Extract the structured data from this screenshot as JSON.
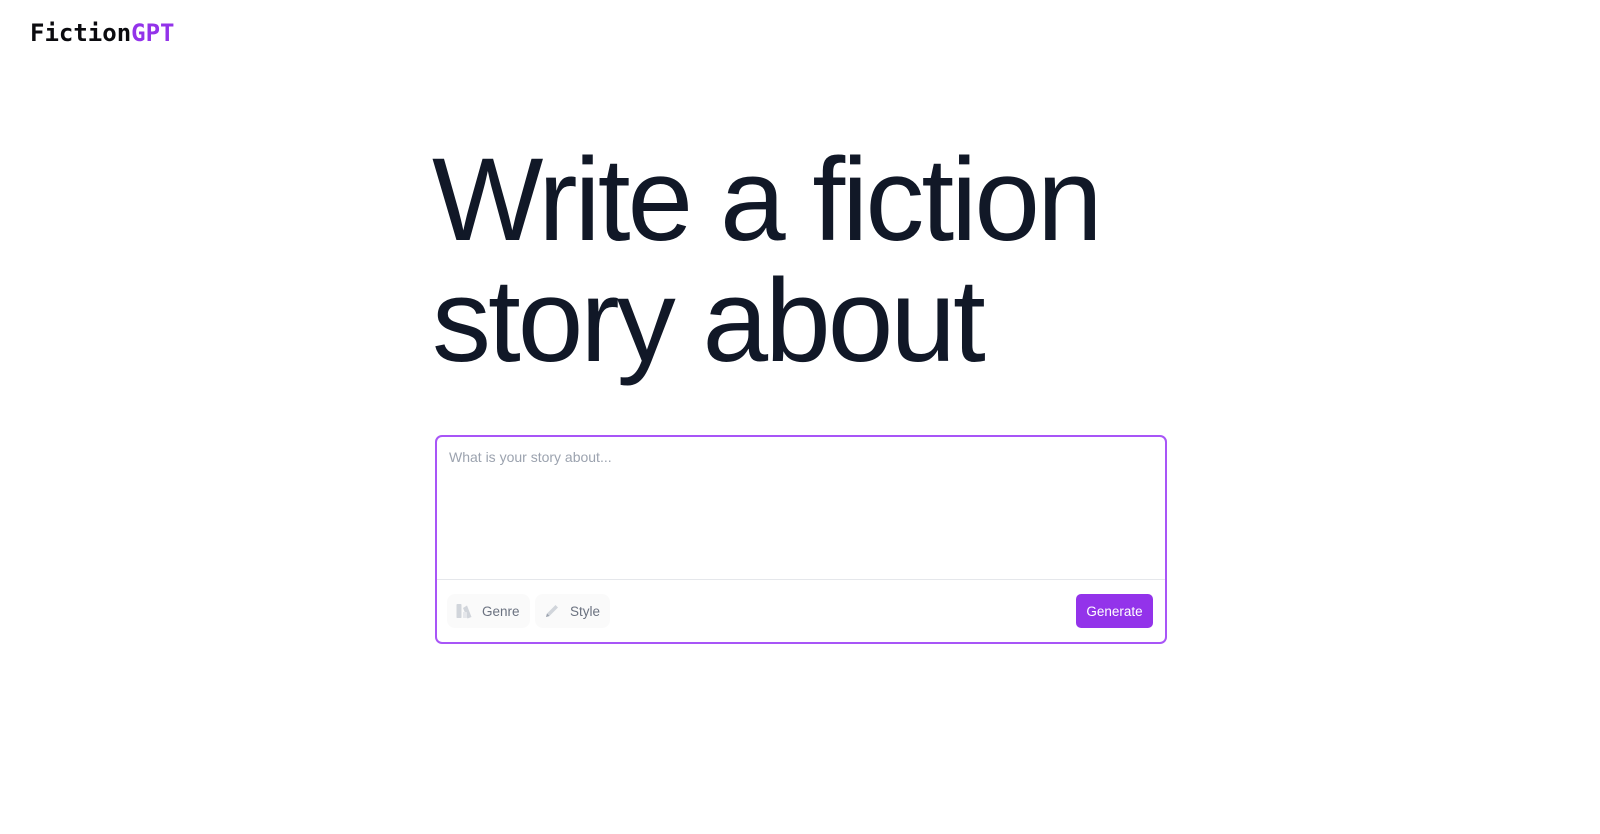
{
  "brand": {
    "name_main": "Fiction",
    "name_accent": "GPT",
    "accent_color": "#9333ea"
  },
  "hero": {
    "line1": "Write a fiction",
    "line2": "story about"
  },
  "composer": {
    "input_value": "",
    "placeholder": "What is your story about...",
    "genre_label": "Genre",
    "genre_icon": "genre-icon",
    "style_label": "Style",
    "style_icon": "pencil-icon",
    "generate_label": "Generate",
    "border_color": "#a855f7"
  }
}
